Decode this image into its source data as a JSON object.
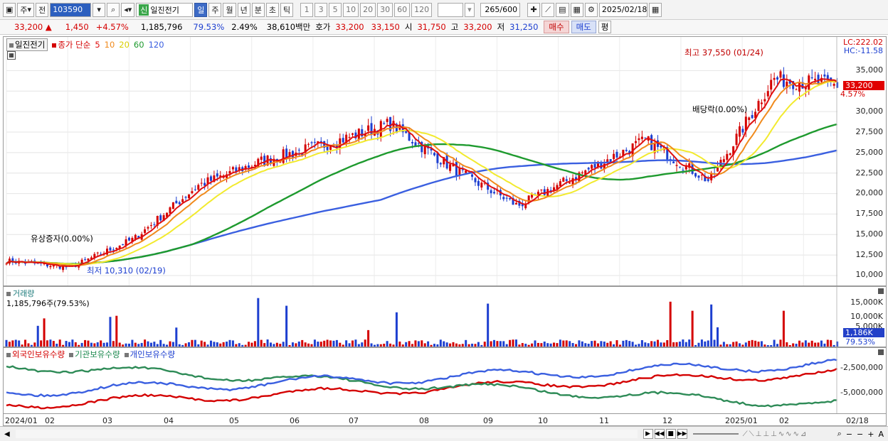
{
  "toolbar": {
    "mode1": "주",
    "mode2": "전",
    "code": "103590",
    "new_badge": "신",
    "name": "일진전기",
    "periods": [
      "일",
      "주",
      "월",
      "년",
      "분",
      "초",
      "틱"
    ],
    "intervals": [
      "1",
      "3",
      "5",
      "10",
      "20",
      "30",
      "60",
      "120"
    ],
    "count": "265",
    "count_total": "/600",
    "date": "2025/02/18"
  },
  "quote": {
    "price": "33,200",
    "change": "1,450",
    "change_pct": "+4.57%",
    "volume": "1,185,796",
    "vol_ratio": "79.53%",
    "turnover": "2.49%",
    "amount": "38,610백만",
    "ask_label": "호가",
    "ask": "33,200",
    "bid": "33,150",
    "open_label": "시",
    "open": "31,750",
    "high_label": "고",
    "high": "33,200",
    "low_label": "저",
    "low": "31,250",
    "buy": "매수",
    "sell": "매도",
    "eval": "평"
  },
  "price_panel": {
    "legend_name": "일진전기",
    "legend_type": "종가 단순",
    "ma": [
      "5",
      "10",
      "20",
      "60",
      "120"
    ],
    "lc": "LC:222.02",
    "hc": "HC:-11.58",
    "cur_price": "33,200",
    "cur_pct": "4.57%",
    "high_note": "최고 37,550 (01/24)",
    "low_note": "최저 10,310 (02/19)",
    "event1": "유상증자(0.00%)",
    "event2": "배당락(0.00%)",
    "yticks": [
      "35,000",
      "32,500",
      "30,000",
      "27,500",
      "25,000",
      "22,500",
      "20,000",
      "17,500",
      "15,000",
      "12,500",
      "10,000"
    ]
  },
  "volume_panel": {
    "title": "거래량",
    "value": "1,185,796주(79.53%)",
    "yticks": [
      "15,000K",
      "10,000K",
      "5,000K"
    ],
    "cur": "1,186K",
    "cur_pct": "79.53%"
  },
  "flow_panel": {
    "legend": [
      "외국인보유수량",
      "기관보유수량",
      "개인보유수량"
    ],
    "yticks": [
      "-2,500,000",
      "-5,000,000"
    ]
  },
  "xaxis": {
    "labels": [
      "2024/01",
      "02",
      "03",
      "04",
      "05",
      "06",
      "07",
      "08",
      "09",
      "10",
      "11",
      "12",
      "2025/01",
      "02",
      "02/18"
    ]
  },
  "colors": {
    "up": "#d40000",
    "down": "#1d3fd0",
    "ma5": "#e01010",
    "ma10": "#f08a1c",
    "ma20": "#f2ea2e",
    "ma60": "#1e9a2e",
    "ma120": "#3a5fe0"
  },
  "chart_data": {
    "type": "line",
    "title": "",
    "series": [
      {
        "name": "종가",
        "points": [
          [
            "2024-01",
            11800
          ],
          [
            "2024-02",
            11000
          ],
          [
            "2024-03",
            14500
          ],
          [
            "2024-04",
            21000
          ],
          [
            "2024-05",
            24000
          ],
          [
            "2024-06",
            26000
          ],
          [
            "2024-07",
            28500
          ],
          [
            "2024-08",
            23000
          ],
          [
            "2024-09",
            18500
          ],
          [
            "2024-10",
            22500
          ],
          [
            "2024-11",
            26500
          ],
          [
            "2024-12",
            21500
          ],
          [
            "2025-01",
            34000
          ],
          [
            "2025-02",
            33200
          ]
        ]
      }
    ],
    "ylim": [
      10000,
      37550
    ]
  }
}
